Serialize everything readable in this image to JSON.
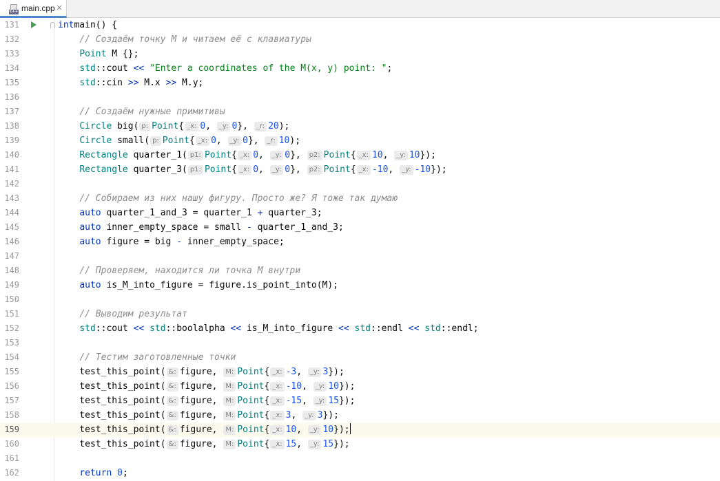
{
  "tabbar": {
    "tab": {
      "name": "main.cpp",
      "icon": "cpp-file-icon",
      "lang_badge": "C++",
      "close": "×"
    }
  },
  "editor": {
    "lines": [
      {
        "n": "131",
        "run": true,
        "fold": true,
        "tokens": [
          [
            "kw",
            "int"
          ],
          [
            "",
            "main() {"
          ]
        ]
      },
      {
        "n": "132",
        "tokens": [
          [
            "",
            "    "
          ],
          [
            "cm",
            "// Создаём точку M и читаем её с клавиатуры"
          ]
        ]
      },
      {
        "n": "133",
        "tokens": [
          [
            "",
            "    "
          ],
          [
            "ty",
            "Point"
          ],
          [
            "",
            " M {};"
          ]
        ]
      },
      {
        "n": "134",
        "tokens": [
          [
            "",
            "    "
          ],
          [
            "ty",
            "std"
          ],
          [
            "",
            "::cout "
          ],
          [
            "op",
            "<<"
          ],
          [
            "",
            " "
          ],
          [
            "str",
            "\"Enter a coordinates of the M(x, y) point: \""
          ],
          [
            "",
            ";"
          ]
        ]
      },
      {
        "n": "135",
        "tokens": [
          [
            "",
            "    "
          ],
          [
            "ty",
            "std"
          ],
          [
            "",
            "::cin "
          ],
          [
            "op",
            ">>"
          ],
          [
            "",
            " M.x "
          ],
          [
            "op",
            ">>"
          ],
          [
            "",
            " M.y;"
          ]
        ]
      },
      {
        "n": "136",
        "tokens": []
      },
      {
        "n": "137",
        "tokens": [
          [
            "",
            "    "
          ],
          [
            "cm",
            "// Создаём нужные примитивы"
          ]
        ]
      },
      {
        "n": "138",
        "tokens": [
          [
            "",
            "    "
          ],
          [
            "ty",
            "Circle"
          ],
          [
            "",
            " big("
          ],
          [
            "hint",
            "p:"
          ],
          [
            "ty",
            "Point"
          ],
          [
            "",
            "{"
          ],
          [
            "hint",
            "_x:"
          ],
          [
            "num",
            "0"
          ],
          [
            "",
            ", "
          ],
          [
            "hint",
            "_y:"
          ],
          [
            "num",
            "0"
          ],
          [
            "",
            "}, "
          ],
          [
            "hint",
            "_r:"
          ],
          [
            "num",
            "20"
          ],
          [
            "",
            ");"
          ]
        ]
      },
      {
        "n": "139",
        "tokens": [
          [
            "",
            "    "
          ],
          [
            "ty",
            "Circle"
          ],
          [
            "",
            " small("
          ],
          [
            "hint",
            "p:"
          ],
          [
            "ty",
            "Point"
          ],
          [
            "",
            "{"
          ],
          [
            "hint",
            "_x:"
          ],
          [
            "num",
            "0"
          ],
          [
            "",
            ", "
          ],
          [
            "hint",
            "_y:"
          ],
          [
            "num",
            "0"
          ],
          [
            "",
            "}, "
          ],
          [
            "hint",
            "_r:"
          ],
          [
            "num",
            "10"
          ],
          [
            "",
            ");"
          ]
        ]
      },
      {
        "n": "140",
        "tokens": [
          [
            "",
            "    "
          ],
          [
            "ty",
            "Rectangle"
          ],
          [
            "",
            " quarter_1("
          ],
          [
            "hint",
            "p1:"
          ],
          [
            "ty",
            "Point"
          ],
          [
            "",
            "{"
          ],
          [
            "hint",
            "_x:"
          ],
          [
            "num",
            "0"
          ],
          [
            "",
            ", "
          ],
          [
            "hint",
            "_y:"
          ],
          [
            "num",
            "0"
          ],
          [
            "",
            "}, "
          ],
          [
            "hint",
            "p2:"
          ],
          [
            "ty",
            "Point"
          ],
          [
            "",
            "{"
          ],
          [
            "hint",
            "_x:"
          ],
          [
            "num",
            "10"
          ],
          [
            "",
            ", "
          ],
          [
            "hint",
            "_y:"
          ],
          [
            "num",
            "10"
          ],
          [
            "",
            "});"
          ]
        ]
      },
      {
        "n": "141",
        "tokens": [
          [
            "",
            "    "
          ],
          [
            "ty",
            "Rectangle"
          ],
          [
            "",
            " quarter_3("
          ],
          [
            "hint",
            "p1:"
          ],
          [
            "ty",
            "Point"
          ],
          [
            "",
            "{"
          ],
          [
            "hint",
            "_x:"
          ],
          [
            "num",
            "0"
          ],
          [
            "",
            ", "
          ],
          [
            "hint",
            "_y:"
          ],
          [
            "num",
            "0"
          ],
          [
            "",
            "}, "
          ],
          [
            "hint",
            "p2:"
          ],
          [
            "ty",
            "Point"
          ],
          [
            "",
            "{"
          ],
          [
            "hint",
            "_x:"
          ],
          [
            "num",
            "-10"
          ],
          [
            "",
            ", "
          ],
          [
            "hint",
            "_y:"
          ],
          [
            "num",
            "-10"
          ],
          [
            "",
            "});"
          ]
        ]
      },
      {
        "n": "142",
        "tokens": []
      },
      {
        "n": "143",
        "tokens": [
          [
            "",
            "    "
          ],
          [
            "cm",
            "// Собираем из них нашу фигуру. Просто же? Я тоже так думаю"
          ]
        ]
      },
      {
        "n": "144",
        "tokens": [
          [
            "",
            "    "
          ],
          [
            "kw",
            "auto"
          ],
          [
            "",
            " quarter_1_and_3 = quarter_1 "
          ],
          [
            "op",
            "+"
          ],
          [
            "",
            " quarter_3;"
          ]
        ]
      },
      {
        "n": "145",
        "tokens": [
          [
            "",
            "    "
          ],
          [
            "kw",
            "auto"
          ],
          [
            "",
            " inner_empty_space = small "
          ],
          [
            "op",
            "-"
          ],
          [
            "",
            " quarter_1_and_3;"
          ]
        ]
      },
      {
        "n": "146",
        "tokens": [
          [
            "",
            "    "
          ],
          [
            "kw",
            "auto"
          ],
          [
            "",
            " figure = big "
          ],
          [
            "op",
            "-"
          ],
          [
            "",
            " inner_empty_space;"
          ]
        ]
      },
      {
        "n": "147",
        "tokens": []
      },
      {
        "n": "148",
        "tokens": [
          [
            "",
            "    "
          ],
          [
            "cm",
            "// Проверяем, находится ли точка M внутри"
          ]
        ]
      },
      {
        "n": "149",
        "tokens": [
          [
            "",
            "    "
          ],
          [
            "kw",
            "auto"
          ],
          [
            "",
            " is_M_into_figure = figure.is_point_into(M);"
          ]
        ]
      },
      {
        "n": "150",
        "tokens": []
      },
      {
        "n": "151",
        "tokens": [
          [
            "",
            "    "
          ],
          [
            "cm",
            "// Выводим результат"
          ]
        ]
      },
      {
        "n": "152",
        "tokens": [
          [
            "",
            "    "
          ],
          [
            "ty",
            "std"
          ],
          [
            "",
            "::cout "
          ],
          [
            "op",
            "<<"
          ],
          [
            "",
            " "
          ],
          [
            "ty",
            "std"
          ],
          [
            "",
            "::boolalpha "
          ],
          [
            "op",
            "<<"
          ],
          [
            "",
            " is_M_into_figure "
          ],
          [
            "op",
            "<<"
          ],
          [
            "",
            " "
          ],
          [
            "ty",
            "std"
          ],
          [
            "",
            "::endl "
          ],
          [
            "op",
            "<<"
          ],
          [
            "",
            " "
          ],
          [
            "ty",
            "std"
          ],
          [
            "",
            "::endl;"
          ]
        ]
      },
      {
        "n": "153",
        "tokens": []
      },
      {
        "n": "154",
        "tokens": [
          [
            "",
            "    "
          ],
          [
            "cm",
            "// Тестим заготовленные точки"
          ]
        ]
      },
      {
        "n": "155",
        "tokens": [
          [
            "",
            "    test_this_point("
          ],
          [
            "hint",
            "&:"
          ],
          [
            "",
            "figure, "
          ],
          [
            "hint",
            "M:"
          ],
          [
            "ty",
            "Point"
          ],
          [
            "",
            "{"
          ],
          [
            "hint",
            "_x:"
          ],
          [
            "num",
            "-3"
          ],
          [
            "",
            ", "
          ],
          [
            "hint",
            "_y:"
          ],
          [
            "num",
            "3"
          ],
          [
            "",
            "});"
          ]
        ]
      },
      {
        "n": "156",
        "tokens": [
          [
            "",
            "    test_this_point("
          ],
          [
            "hint",
            "&:"
          ],
          [
            "",
            "figure, "
          ],
          [
            "hint",
            "M:"
          ],
          [
            "ty",
            "Point"
          ],
          [
            "",
            "{"
          ],
          [
            "hint",
            "_x:"
          ],
          [
            "num",
            "-10"
          ],
          [
            "",
            ", "
          ],
          [
            "hint",
            "_y:"
          ],
          [
            "num",
            "10"
          ],
          [
            "",
            "});"
          ]
        ]
      },
      {
        "n": "157",
        "tokens": [
          [
            "",
            "    test_this_point("
          ],
          [
            "hint",
            "&:"
          ],
          [
            "",
            "figure, "
          ],
          [
            "hint",
            "M:"
          ],
          [
            "ty",
            "Point"
          ],
          [
            "",
            "{"
          ],
          [
            "hint",
            "_x:"
          ],
          [
            "num",
            "-15"
          ],
          [
            "",
            ", "
          ],
          [
            "hint",
            "_y:"
          ],
          [
            "num",
            "15"
          ],
          [
            "",
            "});"
          ]
        ]
      },
      {
        "n": "158",
        "tokens": [
          [
            "",
            "    test_this_point("
          ],
          [
            "hint",
            "&:"
          ],
          [
            "",
            "figure, "
          ],
          [
            "hint",
            "M:"
          ],
          [
            "ty",
            "Point"
          ],
          [
            "",
            "{"
          ],
          [
            "hint",
            "_x:"
          ],
          [
            "num",
            "3"
          ],
          [
            "",
            ", "
          ],
          [
            "hint",
            "_y:"
          ],
          [
            "num",
            "3"
          ],
          [
            "",
            "});"
          ]
        ]
      },
      {
        "n": "159",
        "current": true,
        "caret": true,
        "tokens": [
          [
            "",
            "    test_this_point("
          ],
          [
            "hint",
            "&:"
          ],
          [
            "",
            "figure, "
          ],
          [
            "hint",
            "M:"
          ],
          [
            "ty",
            "Point"
          ],
          [
            "",
            "{"
          ],
          [
            "hint",
            "_x:"
          ],
          [
            "num",
            "10"
          ],
          [
            "",
            ", "
          ],
          [
            "hint",
            "_y:"
          ],
          [
            "num",
            "10"
          ],
          [
            "",
            "});"
          ]
        ]
      },
      {
        "n": "160",
        "tokens": [
          [
            "",
            "    test_this_point("
          ],
          [
            "hint",
            "&:"
          ],
          [
            "",
            "figure, "
          ],
          [
            "hint",
            "M:"
          ],
          [
            "ty",
            "Point"
          ],
          [
            "",
            "{"
          ],
          [
            "hint",
            "_x:"
          ],
          [
            "num",
            "15"
          ],
          [
            "",
            ", "
          ],
          [
            "hint",
            "_y:"
          ],
          [
            "num",
            "15"
          ],
          [
            "",
            "});"
          ]
        ]
      },
      {
        "n": "161",
        "tokens": []
      },
      {
        "n": "162",
        "tokens": [
          [
            "",
            "    "
          ],
          [
            "kw",
            "return"
          ],
          [
            "",
            " "
          ],
          [
            "num",
            "0"
          ],
          [
            "",
            ";"
          ]
        ]
      }
    ]
  }
}
